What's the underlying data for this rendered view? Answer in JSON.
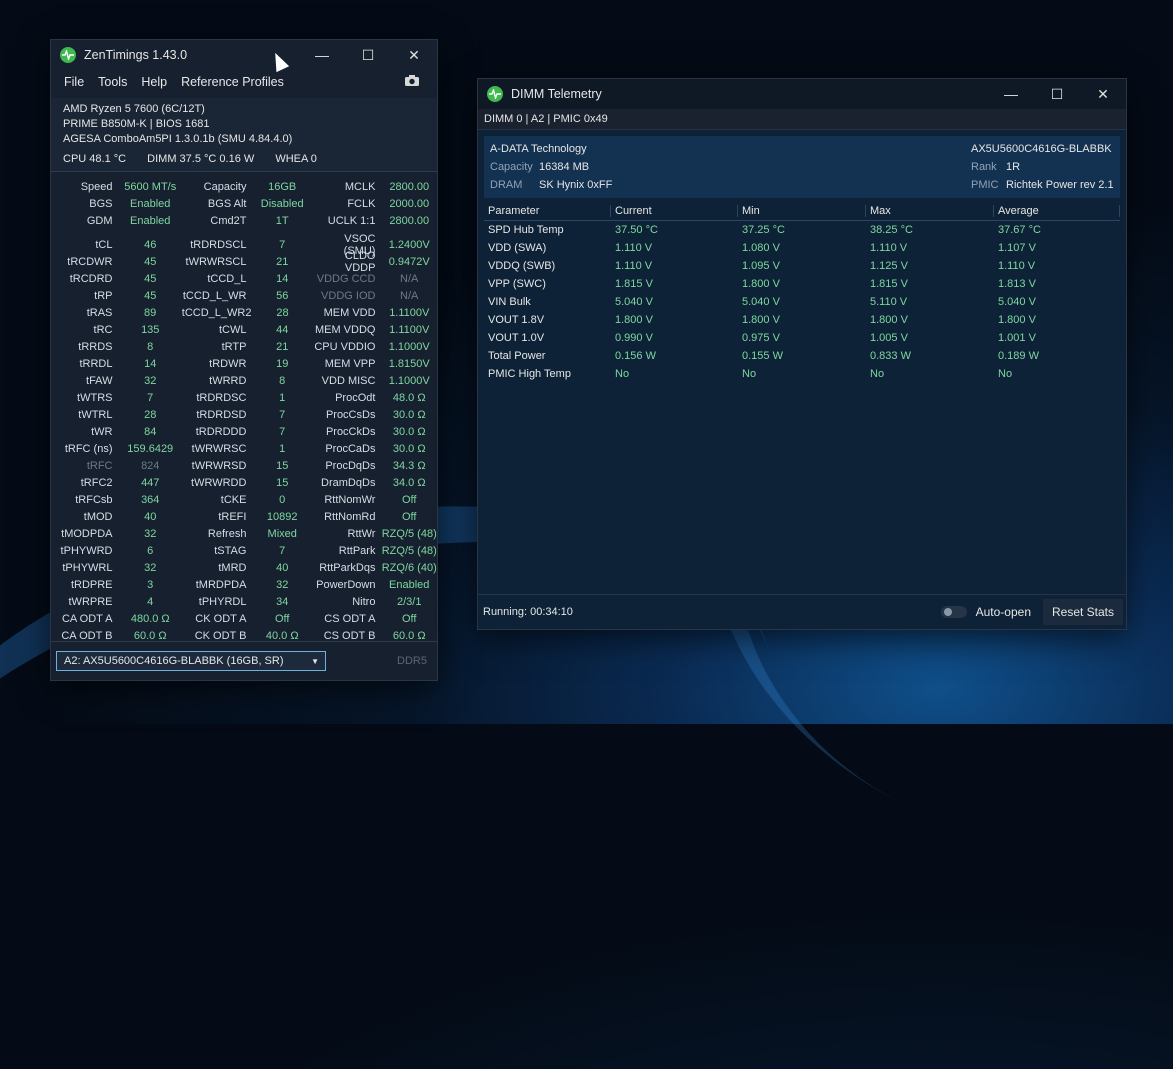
{
  "zt": {
    "title": "ZenTimings 1.43.0",
    "menu": [
      "File",
      "Tools",
      "Help",
      "Reference Profiles"
    ],
    "sys": [
      "AMD Ryzen 5 7600 (6C/12T)",
      "PRIME B850M-K | BIOS 1681",
      "AGESA ComboAm5PI 1.3.0.1b (SMU 4.84.4.0)"
    ],
    "temps": {
      "cpu": "CPU 48.1 °C",
      "dimm": "DIMM 37.5 °C  0.16 W",
      "whea": "WHEA 0"
    },
    "top": [
      [
        "Speed",
        "5600 MT/s",
        "Capacity",
        "16GB",
        "MCLK",
        "2800.00"
      ],
      [
        "BGS",
        "Enabled",
        "BGS Alt",
        "Disabled",
        "FCLK",
        "2000.00"
      ],
      [
        "GDM",
        "Enabled",
        "Cmd2T",
        "1T",
        "UCLK  1:1",
        "2800.00"
      ]
    ],
    "rows": [
      [
        "tCL",
        "46",
        "tRDRDSCL",
        "7",
        "VSOC (SMU)",
        "1.2400V"
      ],
      [
        "tRCDWR",
        "45",
        "tWRWRSCL",
        "21",
        "CLDO VDDP",
        "0.9472V"
      ],
      [
        "tRCDRD",
        "45",
        "tCCD_L",
        "14",
        "VDDG CCD",
        "N/A"
      ],
      [
        "tRP",
        "45",
        "tCCD_L_WR",
        "56",
        "VDDG IOD",
        "N/A"
      ],
      [
        "tRAS",
        "89",
        "tCCD_L_WR2",
        "28",
        "MEM VDD",
        "1.1100V"
      ],
      [
        "tRC",
        "135",
        "tCWL",
        "44",
        "MEM VDDQ",
        "1.1100V"
      ],
      [
        "tRRDS",
        "8",
        "tRTP",
        "21",
        "CPU VDDIO",
        "1.1000V"
      ],
      [
        "tRRDL",
        "14",
        "tRDWR",
        "19",
        "MEM VPP",
        "1.8150V"
      ],
      [
        "tFAW",
        "32",
        "tWRRD",
        "8",
        "VDD MISC",
        "1.1000V"
      ],
      [
        "tWTRS",
        "7",
        "tRDRDSC",
        "1",
        "ProcOdt",
        "48.0 Ω"
      ],
      [
        "tWTRL",
        "28",
        "tRDRDSD",
        "7",
        "ProcCsDs",
        "30.0 Ω"
      ],
      [
        "tWR",
        "84",
        "tRDRDDD",
        "7",
        "ProcCkDs",
        "30.0 Ω"
      ],
      [
        "tRFC (ns)",
        "159.6429",
        "tWRWRSC",
        "1",
        "ProcCaDs",
        "30.0 Ω"
      ],
      [
        "tRFC",
        "824",
        "tWRWRSD",
        "15",
        "ProcDqDs",
        "34.3 Ω"
      ],
      [
        "tRFC2",
        "447",
        "tWRWRDD",
        "15",
        "DramDqDs",
        "34.0 Ω"
      ],
      [
        "tRFCsb",
        "364",
        "tCKE",
        "0",
        "RttNomWr",
        "Off"
      ],
      [
        "tMOD",
        "40",
        "tREFI",
        "10892",
        "RttNomRd",
        "Off"
      ],
      [
        "tMODPDA",
        "32",
        "Refresh",
        "Mixed",
        "RttWr",
        "RZQ/5 (48)"
      ],
      [
        "tPHYWRD",
        "6",
        "tSTAG",
        "7",
        "RttPark",
        "RZQ/5 (48)"
      ],
      [
        "tPHYWRL",
        "32",
        "tMRD",
        "40",
        "RttParkDqs",
        "RZQ/6 (40)"
      ],
      [
        "tRDPRE",
        "3",
        "tMRDPDA",
        "32",
        "PowerDown",
        "Enabled"
      ],
      [
        "tWRPRE",
        "4",
        "tPHYRDL",
        "34",
        "Nitro",
        "2/3/1"
      ],
      [
        "CA ODT A",
        "480.0 Ω",
        "CK ODT A",
        "Off",
        "CS ODT A",
        "Off"
      ],
      [
        "CA ODT B",
        "60.0 Ω",
        "CK ODT B",
        "40.0 Ω",
        "CS ODT B",
        "60.0 Ω"
      ]
    ],
    "dimm_select": "A2: AX5U5600C4616G-BLABBK (16GB, SR)",
    "ddr": "DDR5"
  },
  "dt": {
    "title": "DIMM Telemetry",
    "dimmline": "DIMM 0 | A2 | PMIC 0x49",
    "vendor": "A-DATA Technology",
    "part": "AX5U5600C4616G-BLABBK",
    "capacity_label": "Capacity",
    "capacity": "16384 MB",
    "rank_label": "Rank",
    "rank": "1R",
    "dram_label": "DRAM",
    "dram": "SK Hynix 0xFF",
    "pmic_label": "PMIC",
    "pmic": "Richtek Power rev 2.1",
    "headers": [
      "Parameter",
      "Current",
      "Min",
      "Max",
      "Average"
    ],
    "rows": [
      [
        "SPD Hub Temp",
        "37.50 °C",
        "37.25 °C",
        "38.25 °C",
        "37.67 °C"
      ],
      [
        "VDD (SWA)",
        "1.110 V",
        "1.080 V",
        "1.110 V",
        "1.107 V"
      ],
      [
        "VDDQ (SWB)",
        "1.110 V",
        "1.095 V",
        "1.125 V",
        "1.110 V"
      ],
      [
        "VPP (SWC)",
        "1.815 V",
        "1.800 V",
        "1.815 V",
        "1.813 V"
      ],
      [
        "VIN Bulk",
        "5.040 V",
        "5.040 V",
        "5.110 V",
        "5.040 V"
      ],
      [
        "VOUT 1.8V",
        "1.800 V",
        "1.800 V",
        "1.800 V",
        "1.800 V"
      ],
      [
        "VOUT 1.0V",
        "0.990 V",
        "0.975 V",
        "1.005 V",
        "1.001 V"
      ],
      [
        "Total Power",
        "0.156 W",
        "0.155 W",
        "0.833 W",
        "0.189 W"
      ],
      [
        "PMIC High Temp",
        "No",
        "No",
        "No",
        "No"
      ]
    ],
    "running": "Running: 00:34:10",
    "autoopen": "Auto-open",
    "reset": "Reset Stats"
  }
}
